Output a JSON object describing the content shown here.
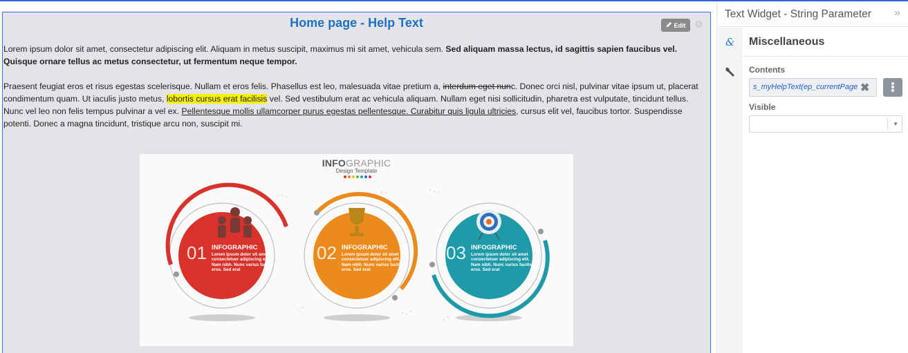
{
  "widget": {
    "title": "Home page - Help Text",
    "edit_label": "Edit",
    "para1": {
      "normal": "Lorem ipsum dolor sit amet, consectetur adipiscing elit. Aliquam in metus suscipit, maximus mi sit amet, vehicula sem. ",
      "bold": "Sed aliquam massa lectus, id sagittis sapien faucibus vel. Quisque ornare tellus ac metus consectetur, ut fermentum neque tempor."
    },
    "para2": {
      "a": "Praesent feugiat eros et risus egestas scelerisque. Nullam et eros felis. Phasellus est leo, malesuada vitae pretium a, ",
      "strike": "interdum eget nun",
      "b": "c. Donec orci nisl, pulvinar vitae ipsum ut, placerat condimentum quam. Ut iaculis justo metus, ",
      "highlight": "lobortis cursus erat facilisis",
      "c": " vel. Sed vestibulum erat ac vehicula aliquam. Nullam eget nisi sollicitudin, pharetra est vulputate, tincidunt tellus. Nunc vel leo non felis tempus pulvinar a vel ex. ",
      "underline": "Pellentesque mollis ullamcorper purus egestas pellentesque. Curabitur quis ligula ultricies",
      "d": ", cursus elit vel, faucibus tortor. Suspendisse potenti. Donec a magna tincidunt, tristique arcu non, suscipit mi."
    },
    "infographic": {
      "title_bold": "INFO",
      "title_light": "GRAPHIC",
      "subtitle": "Design Template",
      "steps": [
        {
          "num": "01",
          "label": "INFOGRAPHIC",
          "text": "Lorem ipsum dolor sit amet consectetuer adipiscing elit. Nam nibh. Nunc varius facilisis eros. Sed erat",
          "color": "#d8322a"
        },
        {
          "num": "02",
          "label": "INFOGRAPHIC",
          "text": "Lorem ipsum dolor sit amet consectetuer adipiscing elit. Nam nibh. Nunc varius facilisis eros. Sed erat",
          "color": "#ec8a1c"
        },
        {
          "num": "03",
          "label": "INFOGRAPHIC",
          "text": "Lorem ipsum dolor sit amet consectetuer adipiscing elit. Nam nibh. Nunc varius facilisis eros. Sed erat",
          "color": "#1f9aa9"
        }
      ]
    }
  },
  "panel": {
    "title": "Text Widget - String Parameter",
    "section_title": "Miscellaneous",
    "contents_label": "Contents",
    "contents_value": "s_myHelpText(ep_currentPageId",
    "visible_label": "Visible",
    "visible_value": ""
  },
  "colors": {
    "accent": "#1f6fc5",
    "border": "#3c6fe0",
    "highlight": "#f7f300"
  }
}
